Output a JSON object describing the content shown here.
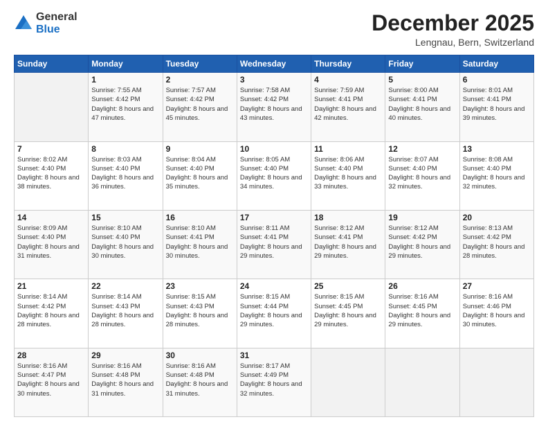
{
  "header": {
    "logo": {
      "general": "General",
      "blue": "Blue"
    },
    "title": "December 2025",
    "location": "Lengnau, Bern, Switzerland"
  },
  "weekdays": [
    "Sunday",
    "Monday",
    "Tuesday",
    "Wednesday",
    "Thursday",
    "Friday",
    "Saturday"
  ],
  "weeks": [
    [
      {
        "day": "",
        "empty": true
      },
      {
        "day": "1",
        "sunrise": "7:55 AM",
        "sunset": "4:42 PM",
        "daylight": "8 hours and 47 minutes."
      },
      {
        "day": "2",
        "sunrise": "7:57 AM",
        "sunset": "4:42 PM",
        "daylight": "8 hours and 45 minutes."
      },
      {
        "day": "3",
        "sunrise": "7:58 AM",
        "sunset": "4:42 PM",
        "daylight": "8 hours and 43 minutes."
      },
      {
        "day": "4",
        "sunrise": "7:59 AM",
        "sunset": "4:41 PM",
        "daylight": "8 hours and 42 minutes."
      },
      {
        "day": "5",
        "sunrise": "8:00 AM",
        "sunset": "4:41 PM",
        "daylight": "8 hours and 40 minutes."
      },
      {
        "day": "6",
        "sunrise": "8:01 AM",
        "sunset": "4:41 PM",
        "daylight": "8 hours and 39 minutes."
      }
    ],
    [
      {
        "day": "7",
        "sunrise": "8:02 AM",
        "sunset": "4:40 PM",
        "daylight": "8 hours and 38 minutes."
      },
      {
        "day": "8",
        "sunrise": "8:03 AM",
        "sunset": "4:40 PM",
        "daylight": "8 hours and 36 minutes."
      },
      {
        "day": "9",
        "sunrise": "8:04 AM",
        "sunset": "4:40 PM",
        "daylight": "8 hours and 35 minutes."
      },
      {
        "day": "10",
        "sunrise": "8:05 AM",
        "sunset": "4:40 PM",
        "daylight": "8 hours and 34 minutes."
      },
      {
        "day": "11",
        "sunrise": "8:06 AM",
        "sunset": "4:40 PM",
        "daylight": "8 hours and 33 minutes."
      },
      {
        "day": "12",
        "sunrise": "8:07 AM",
        "sunset": "4:40 PM",
        "daylight": "8 hours and 32 minutes."
      },
      {
        "day": "13",
        "sunrise": "8:08 AM",
        "sunset": "4:40 PM",
        "daylight": "8 hours and 32 minutes."
      }
    ],
    [
      {
        "day": "14",
        "sunrise": "8:09 AM",
        "sunset": "4:40 PM",
        "daylight": "8 hours and 31 minutes."
      },
      {
        "day": "15",
        "sunrise": "8:10 AM",
        "sunset": "4:40 PM",
        "daylight": "8 hours and 30 minutes."
      },
      {
        "day": "16",
        "sunrise": "8:10 AM",
        "sunset": "4:41 PM",
        "daylight": "8 hours and 30 minutes."
      },
      {
        "day": "17",
        "sunrise": "8:11 AM",
        "sunset": "4:41 PM",
        "daylight": "8 hours and 29 minutes."
      },
      {
        "day": "18",
        "sunrise": "8:12 AM",
        "sunset": "4:41 PM",
        "daylight": "8 hours and 29 minutes."
      },
      {
        "day": "19",
        "sunrise": "8:12 AM",
        "sunset": "4:42 PM",
        "daylight": "8 hours and 29 minutes."
      },
      {
        "day": "20",
        "sunrise": "8:13 AM",
        "sunset": "4:42 PM",
        "daylight": "8 hours and 28 minutes."
      }
    ],
    [
      {
        "day": "21",
        "sunrise": "8:14 AM",
        "sunset": "4:42 PM",
        "daylight": "8 hours and 28 minutes."
      },
      {
        "day": "22",
        "sunrise": "8:14 AM",
        "sunset": "4:43 PM",
        "daylight": "8 hours and 28 minutes."
      },
      {
        "day": "23",
        "sunrise": "8:15 AM",
        "sunset": "4:43 PM",
        "daylight": "8 hours and 28 minutes."
      },
      {
        "day": "24",
        "sunrise": "8:15 AM",
        "sunset": "4:44 PM",
        "daylight": "8 hours and 29 minutes."
      },
      {
        "day": "25",
        "sunrise": "8:15 AM",
        "sunset": "4:45 PM",
        "daylight": "8 hours and 29 minutes."
      },
      {
        "day": "26",
        "sunrise": "8:16 AM",
        "sunset": "4:45 PM",
        "daylight": "8 hours and 29 minutes."
      },
      {
        "day": "27",
        "sunrise": "8:16 AM",
        "sunset": "4:46 PM",
        "daylight": "8 hours and 30 minutes."
      }
    ],
    [
      {
        "day": "28",
        "sunrise": "8:16 AM",
        "sunset": "4:47 PM",
        "daylight": "8 hours and 30 minutes."
      },
      {
        "day": "29",
        "sunrise": "8:16 AM",
        "sunset": "4:48 PM",
        "daylight": "8 hours and 31 minutes."
      },
      {
        "day": "30",
        "sunrise": "8:16 AM",
        "sunset": "4:48 PM",
        "daylight": "8 hours and 31 minutes."
      },
      {
        "day": "31",
        "sunrise": "8:17 AM",
        "sunset": "4:49 PM",
        "daylight": "8 hours and 32 minutes."
      },
      {
        "day": "",
        "empty": true
      },
      {
        "day": "",
        "empty": true
      },
      {
        "day": "",
        "empty": true
      }
    ]
  ],
  "labels": {
    "sunrise": "Sunrise: ",
    "sunset": "Sunset: ",
    "daylight": "Daylight: "
  }
}
